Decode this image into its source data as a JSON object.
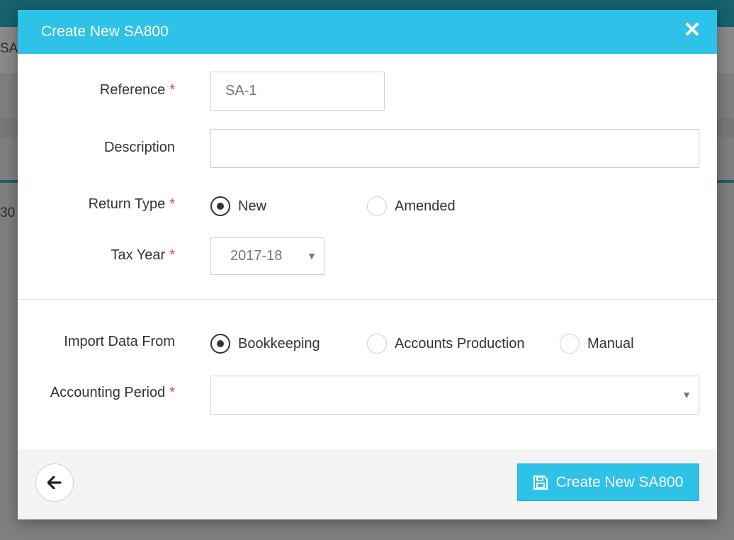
{
  "background": {
    "subbar_text": "SA",
    "row_text": "30"
  },
  "modal": {
    "title": "Create New SA800",
    "close_icon": "close-icon",
    "required_mark": "*",
    "fields": {
      "reference": {
        "label": "Reference",
        "placeholder": "SA-1",
        "value": ""
      },
      "description": {
        "label": "Description",
        "value": ""
      },
      "return_type": {
        "label": "Return Type",
        "options": [
          "New",
          "Amended"
        ],
        "selected": "New"
      },
      "tax_year": {
        "label": "Tax Year",
        "value": "2017-18"
      },
      "import_data_from": {
        "label": "Import Data From",
        "options": [
          "Bookkeeping",
          "Accounts Production",
          "Manual"
        ],
        "selected": "Bookkeeping"
      },
      "accounting_period": {
        "label": "Accounting Period",
        "value": ""
      }
    },
    "footer": {
      "back_icon": "arrow-left-icon",
      "submit_label": "Create New SA800",
      "submit_icon": "save-icon"
    }
  },
  "colors": {
    "accent": "#2ec2e8",
    "required": "#e0443c"
  }
}
